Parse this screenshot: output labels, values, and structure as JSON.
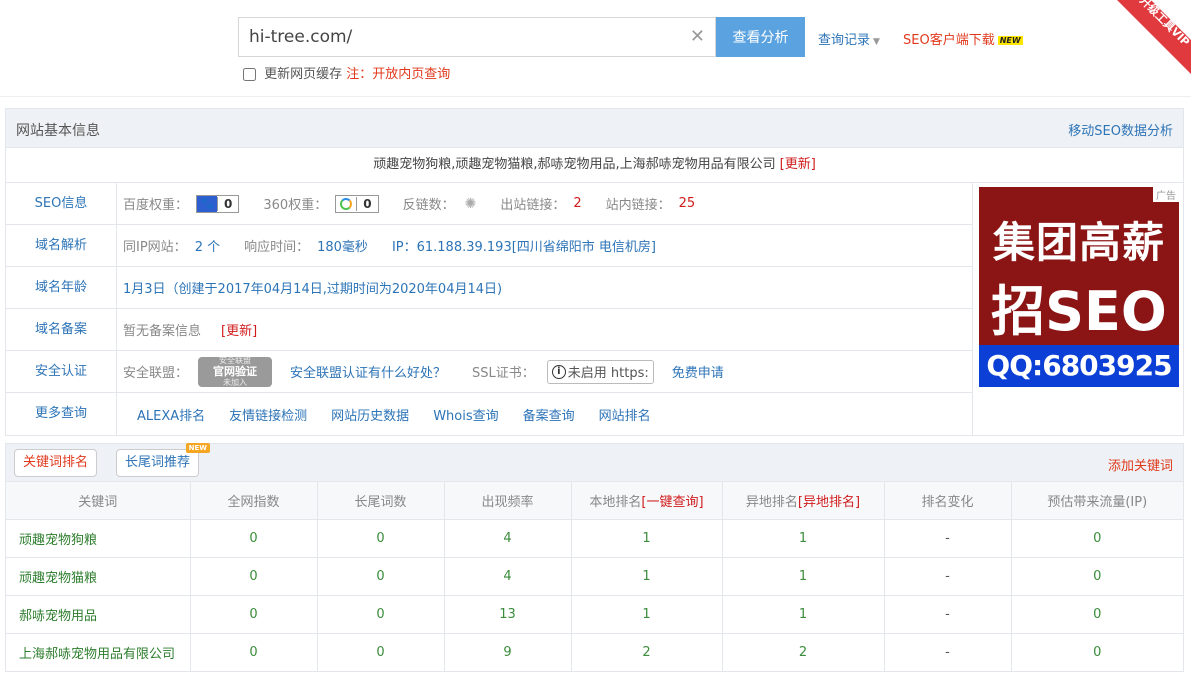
{
  "search": {
    "value": "hi-tree.com/",
    "button_label": "查看分析",
    "history_label": "查询记录",
    "client_label": "SEO客户端下载",
    "new_tag": "NEW",
    "vip_ribbon": "升级工具VIP",
    "refresh_label": "更新网页缓存",
    "note": "注：开放内页查询"
  },
  "basic_info": {
    "title": "网站基本信息",
    "mobile_link": "移动SEO数据分析",
    "site_title": "顽趣宠物狗粮,顽趣宠物猫粮,郝哧宠物用品,上海郝哧宠物用品有限公司",
    "update_label": "[更新]",
    "rows": {
      "seo": {
        "label": "SEO信息",
        "baidu_label": "百度权重：",
        "baidu_value": "0",
        "s360_label": "360权重：",
        "s360_value": "0",
        "backlinks_label": "反链数：",
        "outlinks_label": "出站链接：",
        "outlinks_value": "2",
        "inlinks_label": "站内链接：",
        "inlinks_value": "25"
      },
      "dns": {
        "label": "域名解析",
        "same_ip_label": "同IP网站：",
        "same_ip_value": "2 个",
        "response_label": "响应时间：",
        "response_value": "180毫秒",
        "ip_text": "IP：61.188.39.193[四川省绵阳市 电信机房]"
      },
      "age": {
        "label": "域名年龄",
        "text": "1月3日（创建于2017年04月14日,过期时间为2020年04月14日)"
      },
      "icp": {
        "label": "域名备案",
        "text": "暂无备案信息",
        "update": "[更新]"
      },
      "security": {
        "label": "安全认证",
        "alliance_label": "安全联盟：",
        "seal_top": "安全联盟",
        "seal_mid": "官网验证",
        "seal_bot": "未加入",
        "alliance_link": "安全联盟认证有什么好处？",
        "ssl_label": "SSL证书：",
        "ssl_box": "未启用 https:",
        "ssl_apply": "免费申请"
      },
      "more": {
        "label": "更多查询",
        "links": [
          "ALEXA排名",
          "友情链接检测",
          "网站历史数据",
          "Whois查询",
          "备案查询",
          "网站排名"
        ]
      }
    },
    "ad": {
      "tag": "广告",
      "line1": "集团高薪",
      "line2": "招SEO",
      "qq": "QQ:6803925"
    }
  },
  "keywords": {
    "tab_active": "关键词排名",
    "tab_second": "长尾词推荐",
    "tab_new": "NEW",
    "add_label": "添加关键词",
    "headers": {
      "keyword": "关键词",
      "all_index": "全网指数",
      "long_tail": "长尾词数",
      "frequency": "出现频率",
      "local_rank": "本地排名",
      "local_link": "[一键查询]",
      "remote_rank": "异地排名",
      "remote_link": "[异地排名]",
      "rank_change": "排名变化",
      "traffic": "预估带来流量(IP)"
    },
    "rows": [
      {
        "keyword": "顽趣宠物狗粮",
        "all_index": "0",
        "long_tail": "0",
        "frequency": "4",
        "local_rank": "1",
        "remote_rank": "1",
        "change": "-",
        "traffic": "0"
      },
      {
        "keyword": "顽趣宠物猫粮",
        "all_index": "0",
        "long_tail": "0",
        "frequency": "4",
        "local_rank": "1",
        "remote_rank": "1",
        "change": "-",
        "traffic": "0"
      },
      {
        "keyword": "郝哧宠物用品",
        "all_index": "0",
        "long_tail": "0",
        "frequency": "13",
        "local_rank": "1",
        "remote_rank": "1",
        "change": "-",
        "traffic": "0"
      },
      {
        "keyword": "上海郝哧宠物用品有限公司",
        "all_index": "0",
        "long_tail": "0",
        "frequency": "9",
        "local_rank": "2",
        "remote_rank": "2",
        "change": "-",
        "traffic": "0"
      }
    ]
  }
}
